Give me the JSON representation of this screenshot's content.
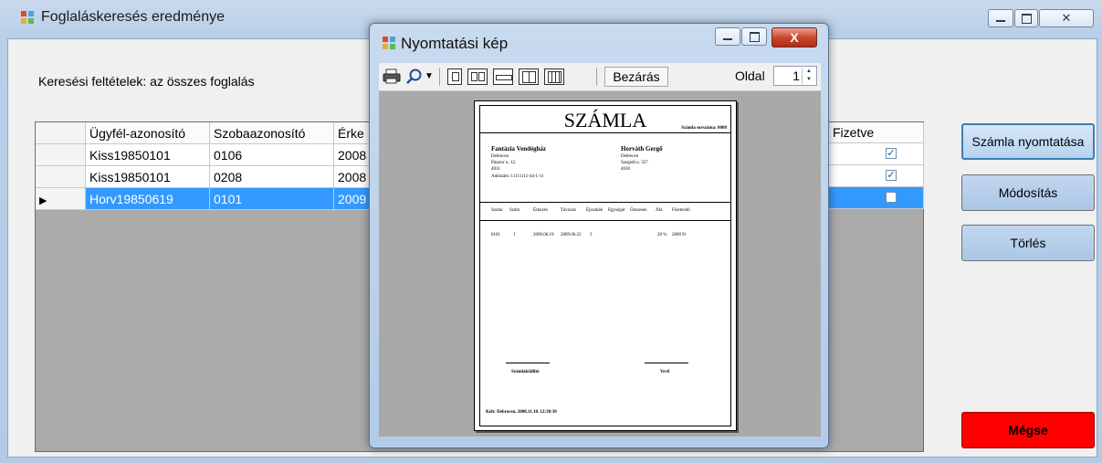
{
  "main_window": {
    "title": "Foglaláskeresés eredménye",
    "criteria_label": "Keresési feltételek:  az összes foglalás",
    "window_controls": [
      "minimize-icon",
      "maximize-icon",
      "close-icon"
    ]
  },
  "grid": {
    "columns": [
      "Ügyfél-azonosító",
      "Szobaazonosító",
      "Érke",
      "Fizetve"
    ],
    "rows": [
      {
        "customer": "Kiss19850101",
        "room": "0106",
        "arrival": "2008",
        "paid": true,
        "selected": false
      },
      {
        "customer": "Kiss19850101",
        "room": "0208",
        "arrival": "2008",
        "paid": true,
        "selected": false
      },
      {
        "customer": "Horv19850619",
        "room": "0101",
        "arrival": "2009",
        "paid": false,
        "selected": true
      }
    ],
    "current_row_marker": "▶"
  },
  "buttons": {
    "print": "Számla nyomtatása",
    "modify": "Módosítás",
    "delete": "Törlés",
    "cancel": "Mégse"
  },
  "preview": {
    "title": "Nyomtatási kép",
    "close_label": "X",
    "toolbar": {
      "close_button": "Bezárás",
      "page_label": "Oldal",
      "page_value": "1"
    },
    "invoice": {
      "heading": "SZÁMLA",
      "number_line": "Számla sorszáma: 0008",
      "seller_name": "Fantázia Vendégház",
      "seller_lines": [
        "Debrecen",
        "Pásztor u. 12.",
        "4031",
        "Adószám: 11111111-44-1-11"
      ],
      "buyer_name": "Horváth Gergő",
      "buyer_lines": [
        "Debrecen",
        "Szegedi u. 357",
        "4030"
      ],
      "table_header": [
        "Szoba",
        "Szám",
        "Érkezés",
        "Távozás",
        "Éjszakák",
        "Egységár",
        "Összesen",
        "Áfa",
        "Fizetendő"
      ],
      "table_row": [
        "0101",
        "1",
        "2009.06.19",
        "2009.06.22",
        "3",
        "",
        "",
        "20 %",
        "2000 Ft"
      ],
      "sign_left": "Számlakiállító",
      "sign_right": "Vevő",
      "footer": "Kelt: Debrecen, 2008.11.18. 12:30:30"
    }
  },
  "colors": {
    "selection": "#3399ff",
    "cancel_button": "#ff0000",
    "window_frame": "#b9cfe8"
  }
}
